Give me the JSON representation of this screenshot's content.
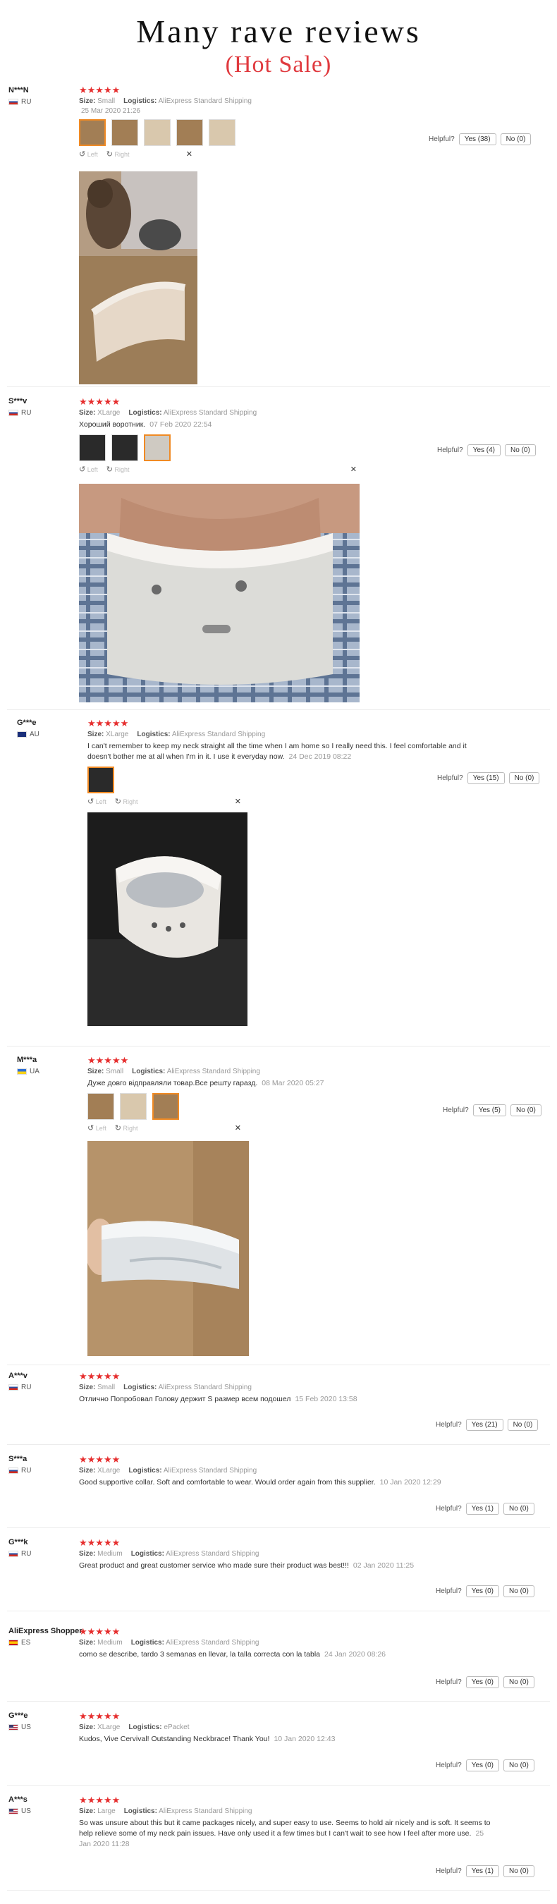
{
  "header": {
    "title": "Many rave reviews",
    "subtitle": "(Hot Sale)"
  },
  "labels": {
    "size": "Size:",
    "logistics": "Logistics:",
    "helpful": "Helpful?",
    "left": "Left",
    "right": "Right",
    "stars": "★★★★★"
  },
  "reviews": [
    {
      "user": "N***N",
      "country": "RU",
      "size": "Small",
      "logistics": "AliExpress Standard Shipping",
      "text": "",
      "date": "25 Mar 2020 21:26",
      "yes": "Yes (38)",
      "no": "No (0)"
    },
    {
      "user": "S***v",
      "country": "RU",
      "size": "XLarge",
      "logistics": "AliExpress Standard Shipping",
      "text": "Хороший воротник.",
      "date": "07 Feb 2020 22:54",
      "yes": "Yes (4)",
      "no": "No (0)"
    },
    {
      "user": "G***e",
      "country": "AU",
      "size": "XLarge",
      "logistics": "AliExpress Standard Shipping",
      "text": "I can't remember to keep my neck straight all the time when I am home so I really need this. I feel comfortable and it doesn't bother me at all when I'm in it. I use it everyday now.",
      "date": "24 Dec 2019 08:22",
      "yes": "Yes (15)",
      "no": "No (0)"
    },
    {
      "user": "M***a",
      "country": "UA",
      "size": "Small",
      "logistics": "AliExpress Standard Shipping",
      "text": "Дуже довго відправляли товар.Все решту гаразд.",
      "date": "08 Mar 2020 05:27",
      "yes": "Yes (5)",
      "no": "No (0)"
    },
    {
      "user": "A***v",
      "country": "RU",
      "size": "Small",
      "logistics": "AliExpress Standard Shipping",
      "text": "Отлично Попробовал Голову держит S размер всем подошел",
      "date": "15 Feb 2020 13:58",
      "yes": "Yes (21)",
      "no": "No (0)"
    },
    {
      "user": "S***a",
      "country": "RU",
      "size": "XLarge",
      "logistics": "AliExpress Standard Shipping",
      "text": "Good supportive collar. Soft and comfortable to wear. Would order again from this supplier.",
      "date": "10 Jan 2020 12:29",
      "yes": "Yes (1)",
      "no": "No (0)"
    },
    {
      "user": "G***k",
      "country": "RU",
      "size": "Medium",
      "logistics": "AliExpress Standard Shipping",
      "text": "Great product and great customer service who made sure their product was best!!!",
      "date": "02 Jan 2020 11:25",
      "yes": "Yes (0)",
      "no": "No (0)"
    },
    {
      "user": "AliExpress Shopper",
      "country": "ES",
      "size": "Medium",
      "logistics": "AliExpress Standard Shipping",
      "text": "como se describe, tardo 3 semanas en llevar, la talla correcta con la tabla",
      "date": "24 Jan 2020 08:26",
      "yes": "Yes (0)",
      "no": "No (0)"
    },
    {
      "user": "G***e",
      "country": "US",
      "size": "XLarge",
      "logistics": "ePacket",
      "text": "Kudos, Vive Cervival! Outstanding Neckbrace! Thank You!",
      "date": "10 Jan 2020 12:43",
      "yes": "Yes (0)",
      "no": "No (0)"
    },
    {
      "user": "A***s",
      "country": "US",
      "size": "Large",
      "logistics": "AliExpress Standard Shipping",
      "text": "So was unsure about this but it came packages nicely, and super easy to use. Seems to hold air nicely and is soft. It seems to help relieve some of my neck pain issues. Have only used it a few times but I can't wait to see how I feel after more use.",
      "date": "25 Jan 2020 11:28",
      "yes": "Yes (1)",
      "no": "No (0)"
    }
  ],
  "colors": {
    "star": "#e62e2e",
    "subtitle": "#e0393e",
    "thumb_active": "#f08a24"
  }
}
